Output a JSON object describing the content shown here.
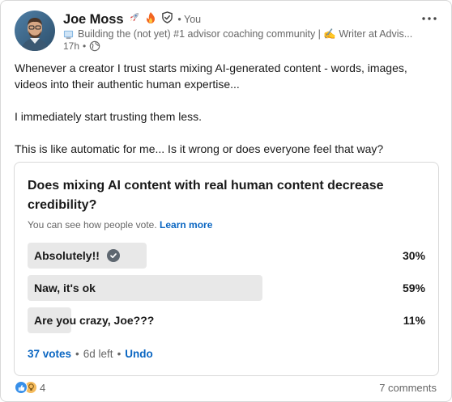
{
  "author": {
    "name": "Joe Moss",
    "you_label": "You",
    "headline": "Building the (not yet) #1 advisor coaching community | ✍️ Writer at Advis...",
    "time": "17h"
  },
  "post": {
    "paragraphs": [
      "Whenever a creator I trust starts mixing AI-generated content - words, images, videos into their authentic human expertise...",
      "I immediately start trusting them less.",
      "This is like automatic for me... Is it wrong or does everyone feel that way?"
    ]
  },
  "poll": {
    "question": "Does mixing AI content with real human content decrease credibility?",
    "note": "You can see how people vote.",
    "learn_more": "Learn more",
    "options": [
      {
        "label": "Absolutely!!",
        "percent_text": "30%",
        "percent": 30,
        "selected": true
      },
      {
        "label": "Naw, it's ok",
        "percent_text": "59%",
        "percent": 59,
        "selected": false
      },
      {
        "label": "Are you crazy, Joe???",
        "percent_text": "11%",
        "percent": 11,
        "selected": false
      }
    ],
    "votes": "37 votes",
    "time_left": "6d left",
    "undo": "Undo"
  },
  "social": {
    "reaction_count": "4",
    "comments": "7 comments"
  },
  "icons": {
    "rocket": "rocket-icon",
    "fire": "fire-icon",
    "verified": "shield-check-icon",
    "globe": "globe-icon",
    "more": "ellipsis-icon"
  },
  "colors": {
    "link": "#0a66c2",
    "bar": "#e8e8e8",
    "text": "#191919",
    "muted": "#666666"
  }
}
